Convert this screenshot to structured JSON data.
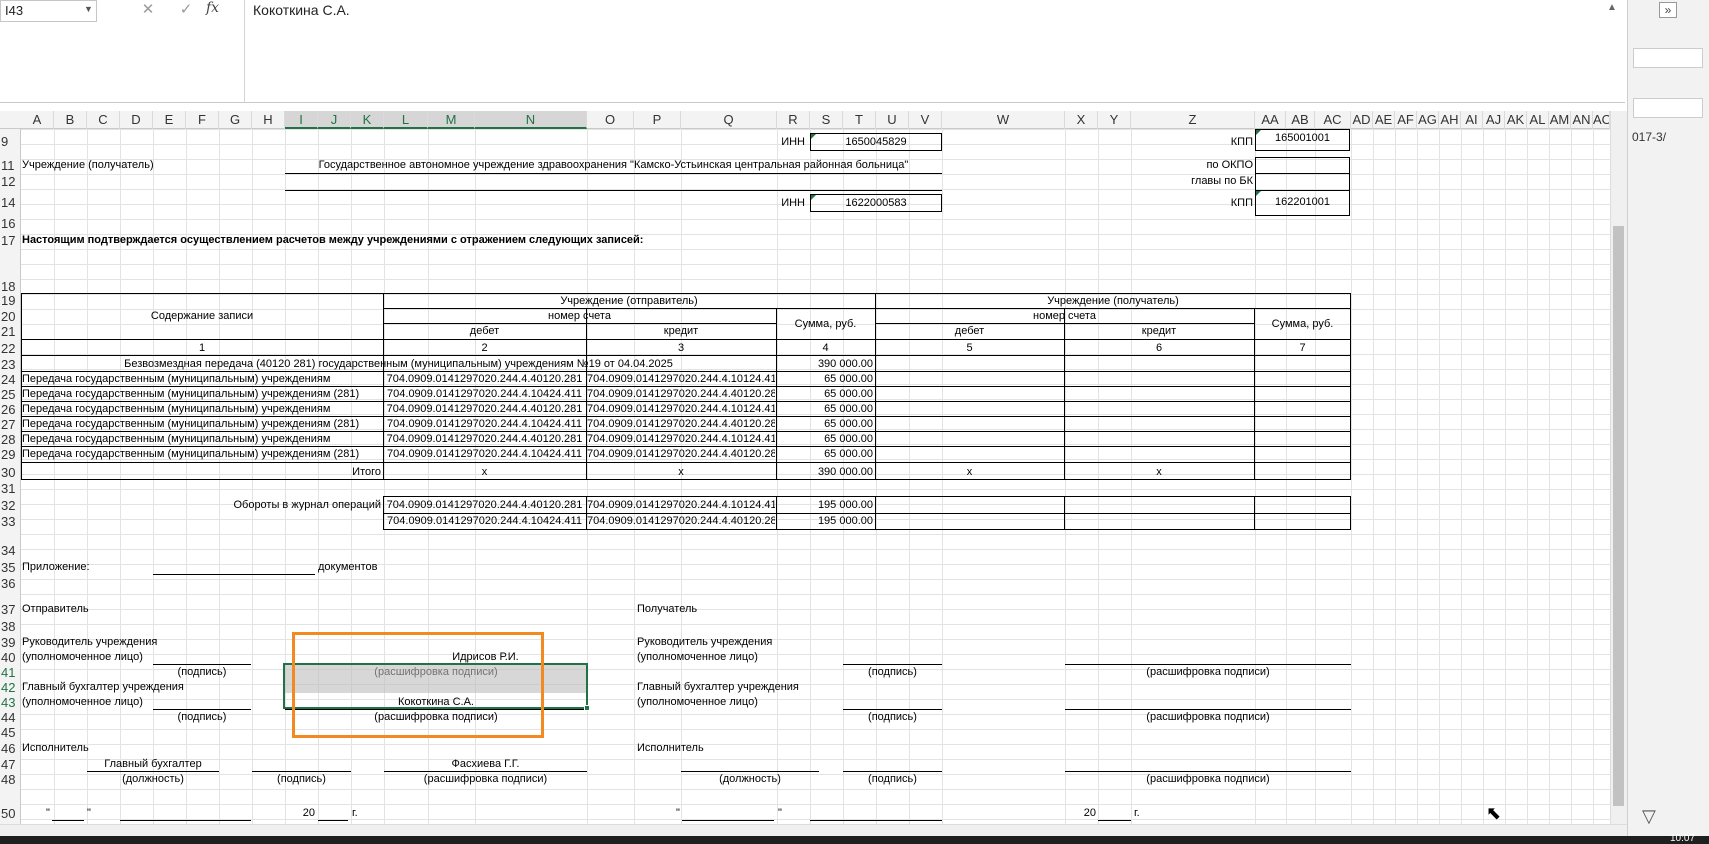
{
  "formula_bar": {
    "name_box": "I43",
    "cancel_icon": "✕",
    "enter_icon": "✓",
    "fx_label": "fx",
    "formula": "Кокоткина С.А."
  },
  "columns": [
    "A",
    "B",
    "C",
    "D",
    "E",
    "F",
    "G",
    "H",
    "I",
    "J",
    "K",
    "L",
    "M",
    "N",
    "O",
    "P",
    "Q",
    "R",
    "S",
    "T",
    "U",
    "V",
    "W",
    "X",
    "Y",
    "Z",
    "AA",
    "AB",
    "AC",
    "AD",
    "AE",
    "AF",
    "AG",
    "AH",
    "AI",
    "AJ",
    "AK",
    "AL",
    "AM",
    "AN",
    "AO"
  ],
  "rows": {
    "r9": "9",
    "r11": "11",
    "r12": "12",
    "r14": "14",
    "r16": "16",
    "r17": "17",
    "r18": "18",
    "r19": "19",
    "r20": "20",
    "r21": "21",
    "r22": "22",
    "r23": "23",
    "r24": "24",
    "r25": "25",
    "r26": "26",
    "r27": "27",
    "r28": "28",
    "r29": "29",
    "r30": "30",
    "r31": "31",
    "r32": "32",
    "r33": "33",
    "r34": "34",
    "r35": "35",
    "r36": "36",
    "r37": "37",
    "r38": "38",
    "r39": "39",
    "r40": "40",
    "r41": "41",
    "r42": "42",
    "r43": "43",
    "r44": "44",
    "r45": "45",
    "r46": "46",
    "r47": "47",
    "r48": "48",
    "r50": "50"
  },
  "header": {
    "inn_label": "ИНН",
    "inn_sender": "1650045829",
    "kpp_label": "КПП",
    "kpp_sender": "165001001",
    "recipient_label": "Учреждение (получатель)",
    "recipient_name": "Государственное автономное учреждение здравоохранения \"Камско-Устьинская центральная районная больница\"",
    "okpo_label": "по ОКПО",
    "glava_label": "главы по БК",
    "inn_recipient": "1622000583",
    "kpp_recipient": "162201001",
    "statement": "Настоящим подтверждается осуществлением расчетов между учреждениями с отражением следующих записей:"
  },
  "table": {
    "col_content": "Содержание записи",
    "sender_group": "Учреждение (отправитель)",
    "recipient_group": "Учреждение (получатель)",
    "account_number": "номер счета",
    "debit": "дебет",
    "credit": "кредит",
    "sum": "Сумма, руб.",
    "nums": [
      "1",
      "2",
      "3",
      "4",
      "5",
      "6",
      "7"
    ],
    "row23_content": "Безвозмездная передача (40120 281) государственным (муниципальным) учреждениям №19 от 04.04.2025",
    "row23_sum": "390 000.00",
    "rows": [
      {
        "content": "Передача государственным (муниципальным) учреждениям",
        "debit": "704.0909.0141297020.244.4.40120.281",
        "credit": "704.0909.0141297020.244.4.10124.410",
        "sum": "65 000.00"
      },
      {
        "content": "Передача государственным (муниципальным) учреждениям (281)",
        "debit": "704.0909.0141297020.244.4.10424.411",
        "credit": "704.0909.0141297020.244.4.40120.281",
        "sum": "65 000.00"
      },
      {
        "content": "Передача государственным (муниципальным) учреждениям",
        "debit": "704.0909.0141297020.244.4.40120.281",
        "credit": "704.0909.0141297020.244.4.10124.410",
        "sum": "65 000.00"
      },
      {
        "content": "Передача государственным (муниципальным) учреждениям (281)",
        "debit": "704.0909.0141297020.244.4.10424.411",
        "credit": "704.0909.0141297020.244.4.40120.281",
        "sum": "65 000.00"
      },
      {
        "content": "Передача государственным (муниципальным) учреждениям",
        "debit": "704.0909.0141297020.244.4.40120.281",
        "credit": "704.0909.0141297020.244.4.10124.410",
        "sum": "65 000.00"
      },
      {
        "content": "Передача государственным (муниципальным) учреждениям (281)",
        "debit": "704.0909.0141297020.244.4.10424.411",
        "credit": "704.0909.0141297020.244.4.40120.281",
        "sum": "65 000.00"
      }
    ],
    "total_label": "Итого",
    "x": "x",
    "total_sum": "390 000.00"
  },
  "turnovers": {
    "label": "Обороты в журнал операций",
    "r1_debit": "704.0909.0141297020.244.4.40120.281",
    "r1_credit": "704.0909.0141297020.244.4.10124.410",
    "r1_sum": "195 000.00",
    "r2_debit": "704.0909.0141297020.244.4.10424.411",
    "r2_credit": "704.0909.0141297020.244.4.40120.281",
    "r2_sum": "195 000.00"
  },
  "footer": {
    "attachment": "Приложение:",
    "documents": "документов",
    "sender": "Отправитель",
    "receiver": "Получатель",
    "head": "Руководитель учреждения",
    "authorized": "(уполномоченное лицо)",
    "signature": "(подпись)",
    "decoding": "(расшифровка подписи)",
    "head_name": "Идрисов Р.И.",
    "chief_acc": "Главный бухгалтер учреждения",
    "chief_acc_name": "Кокоткина С.А.",
    "executor": "Исполнитель",
    "position_value": "Главный бухгалтер",
    "position": "(должность)",
    "executor_name": "Фасхиева Г.Г.",
    "quote": "\"",
    "year_prefix": "20",
    "year_suffix": "г."
  },
  "side": {
    "text": "017-3/",
    "expand": "»",
    "tri": "▽"
  },
  "clock": "10:07"
}
